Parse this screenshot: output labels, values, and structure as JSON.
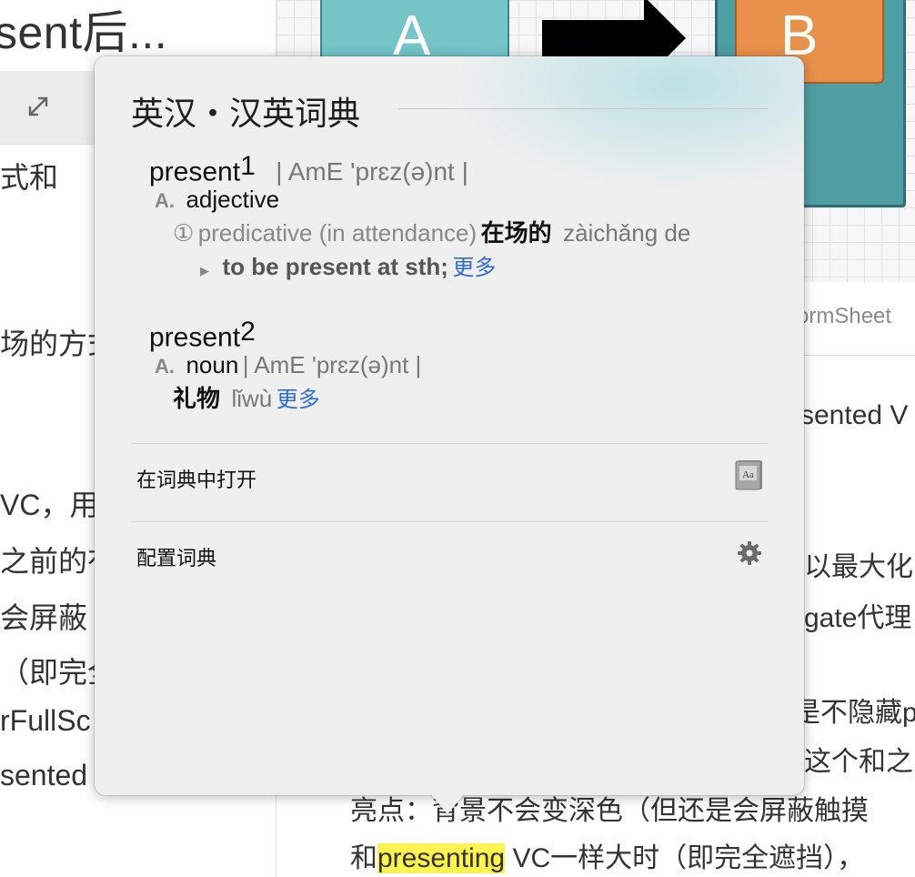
{
  "background": {
    "left_doc": {
      "title": "sent后...",
      "lines": [
        "式和",
        "场的方式",
        "VC，用",
        "之前的有",
        "会屏蔽",
        "（即完全",
        "rFullSc",
        "sented"
      ]
    },
    "diagram": {
      "box_a_label": "A",
      "box_b_label": "B",
      "caption": "ormSheet"
    },
    "right_doc": {
      "lines": [
        "sented V",
        "以最大化",
        "gate代理",
        "是不隐藏p",
        "这个和之",
        "亮点：背景不会变深色（但还是会屏蔽触摸"
      ],
      "bottom_prefix": "和",
      "highlighted_word": "presenting",
      "bottom_suffix": " VC一样大时（即完全遮挡），"
    }
  },
  "popover": {
    "title": "英汉・汉英词典",
    "entries": [
      {
        "headword": "present",
        "sup": "1",
        "pron": "| AmE 'prɛz(ə)nt |",
        "pos_letter": "A.",
        "pos": "adjective",
        "sense_num": "①",
        "sense_gloss": "predicative (in attendance)",
        "sense_cn": "在场的",
        "sense_pinyin": "zàichǎng de",
        "example": "to be present at sth;",
        "more": "更多"
      },
      {
        "headword": "present",
        "sup": "2",
        "pos_letter": "A.",
        "pos": "noun",
        "pron": "| AmE 'prɛz(ə)nt |",
        "cn": "礼物",
        "pinyin": "lǐwù",
        "more": "更多"
      }
    ],
    "actions": {
      "open_in_dictionary": "在词典中打开",
      "configure_dictionary": "配置词典"
    },
    "icons": {
      "book": "dictionary-app-icon",
      "gear": "gear-icon"
    }
  }
}
